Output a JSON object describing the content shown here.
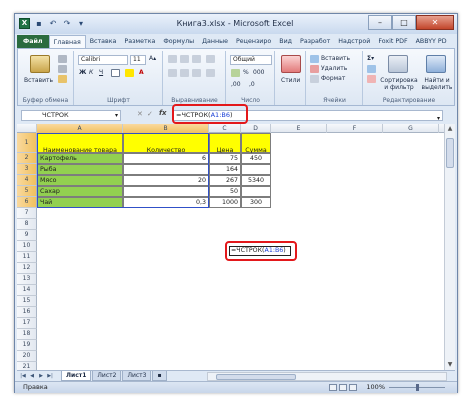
{
  "window": {
    "title": "Книга3.xlsx - Microsoft Excel",
    "app_icon": "X",
    "quick_access": [
      "save-icon",
      "undo-icon",
      "redo-icon",
      "dropdown-icon"
    ],
    "buttons": {
      "minimize": "–",
      "maximize": "□",
      "close": "✕"
    }
  },
  "tabs": [
    "Файл",
    "Главная",
    "Вставка",
    "Разметка",
    "Формулы",
    "Данные",
    "Рецензиро",
    "Вид",
    "Разработ",
    "Надстрой",
    "Foxit PDF",
    "ABBYY PD"
  ],
  "ribbon": {
    "paste_label": "Вставить",
    "font_name": "Calibri",
    "font_size": "11",
    "group_clipboard": "Буфер обмена",
    "group_font": "Шрифт",
    "group_alignment": "Выравнивание",
    "number_format": "Общий",
    "group_number": "Число",
    "styles_label": "Стили",
    "insert_label": "Вставить",
    "delete_label": "Удалить",
    "format_label": "Формат",
    "group_cells": "Ячейки",
    "sort_label": "Сортировка и фильтр",
    "find_label": "Найти и выделить",
    "group_editing": "Редактирование"
  },
  "formula_bar": {
    "name_box": "ЧСТРОК",
    "formula_prefix": "=ЧСТРОК(",
    "formula_ref": "A1:B6",
    "formula_suffix": ")",
    "fx": "fx"
  },
  "grid": {
    "columns": [
      "A",
      "B",
      "C",
      "D",
      "E",
      "F",
      "G",
      "H"
    ],
    "rows": [
      "1",
      "2",
      "3",
      "4",
      "5",
      "6",
      "7",
      "8",
      "9",
      "10",
      "11",
      "12",
      "13",
      "14",
      "15",
      "16",
      "17",
      "18",
      "19",
      "20",
      "21",
      "22",
      "23",
      "24"
    ],
    "header_row": [
      "Наименование товара",
      "Количество",
      "Цена",
      "Сумма"
    ],
    "data": [
      [
        "Картофель",
        "6",
        "75",
        "450"
      ],
      [
        "Рыба",
        "",
        "164",
        ""
      ],
      [
        "Мясо",
        "20",
        "267",
        "5340"
      ],
      [
        "Сахар",
        "",
        "50",
        ""
      ],
      [
        "Чай",
        "0,3",
        "1000",
        "300"
      ]
    ],
    "edit_cell_prefix": "=ЧСТРОК(",
    "edit_cell_ref": "A1:B6",
    "edit_cell_suffix": ")"
  },
  "sheets": [
    "Лист1",
    "Лист2",
    "Лист3"
  ],
  "status": {
    "mode": "Правка",
    "zoom": "100%"
  },
  "colors": {
    "header_yellow": "#ffff00",
    "name_green": "#92d050",
    "highlight_red": "#e3181b",
    "ref_blue": "#1a3fd6"
  }
}
